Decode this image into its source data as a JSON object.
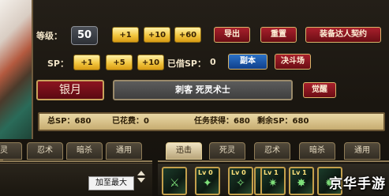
{
  "level": {
    "label": "等级：",
    "value": "50"
  },
  "level_buttons": [
    "+1",
    "+10",
    "+60"
  ],
  "top_actions": {
    "export": "导出",
    "reset": "重置",
    "contract": "装备达人契约"
  },
  "sp": {
    "label": "SP：",
    "buttons": [
      "+1",
      "+5",
      "+10"
    ],
    "borrowed_label": "已借SP：",
    "borrowed_value": "0"
  },
  "mode_buttons": {
    "dungeon": "副本",
    "arena": "决斗场"
  },
  "character": {
    "name": "银月",
    "class": "刺客  死灵术士",
    "awaken": "觉醒"
  },
  "summary": {
    "total_sp": "总SP：680",
    "spent": "已花费：0",
    "quest": "任务获得：680",
    "remaining": "剩余SP：680"
  },
  "left_tabs": [
    "灵",
    "忍术",
    "暗杀",
    "通用"
  ],
  "right_tabs": [
    "迅击",
    "死灵",
    "忍术",
    "暗杀",
    "通用"
  ],
  "active_right_tab": "迅击",
  "add_max_label": "加至最大",
  "skill_slots": [
    {
      "lv": "",
      "icon": "sword-skill-icon"
    },
    {
      "lv": "Lv 0",
      "icon": "skill-icon"
    },
    {
      "lv": "Lv 0",
      "icon": "skill-icon"
    },
    {
      "lv": "",
      "icon": "skill-icon"
    },
    {
      "lv": "Lv 1",
      "icon": "skill-icon"
    },
    {
      "lv": "Lv 1",
      "icon": "skill-icon"
    },
    {
      "lv": "",
      "icon": "skill-icon"
    }
  ],
  "watermark": "京华手游"
}
